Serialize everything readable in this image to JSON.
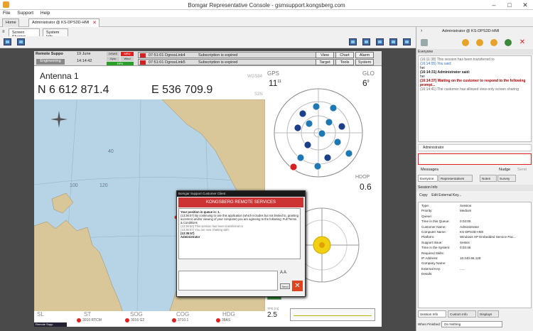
{
  "window": {
    "title": "Bomgar Representative Console - gsmsupport.kongsberg.com"
  },
  "menu": [
    "File",
    "Support",
    "Help"
  ],
  "tabs": {
    "home": "Home",
    "session": "Administrator @ KS-DPS3D-HMI"
  },
  "subtabs": [
    "Screen Sharing",
    "System Info"
  ],
  "remote": {
    "header": {
      "left_label": "Remote Suppo",
      "date": "19 June",
      "time": "14:14:42",
      "mode": "Engineering",
      "ind1": "DSWS",
      "ind2": "MRU",
      "ind3": "Gyro",
      "ind4": "Wind",
      "ind5": "RPS"
    },
    "alarms": [
      {
        "time": "07:51:01",
        "name": "DgnssLink4",
        "msg": "Subscription is expired"
      },
      {
        "time": "07:51:01",
        "name": "DgnssLink5",
        "msg": "Subscription is expired"
      }
    ],
    "buttons": [
      "View",
      "Chart",
      "Alarm",
      "Target",
      "Tools",
      "System"
    ],
    "antenna": "Antenna 1",
    "north": "N 6 612 871.4",
    "east": "E 536 709.9",
    "datum": "WGS84",
    "s2n": "S2N",
    "gps_label": "GPS",
    "gps_value": "11",
    "gps_sub": "11",
    "glo_label": "GLO",
    "glo_value": "6",
    "glo_sub": "9",
    "hdop_label": "HDOP",
    "hdop_value": "0.6",
    "grid_labels": [
      "40",
      "120",
      "100"
    ],
    "bottom": {
      "labels": [
        "SL",
        "ST",
        "SOG",
        "COG",
        "HDG"
      ],
      "values": [
        "3010 RTCM",
        "3016 G2",
        "3710.1",
        "38AS"
      ],
      "status_label": "Remote Supp"
    },
    "h_value": "2.5",
    "h_label": "TPE [m]"
  },
  "chat_popup": {
    "title": "Bomgar Support Customer Client",
    "header": "KONGSBERG REMOTE SERVICES",
    "lines": [
      {
        "t": "Your position in queue is: 1.",
        "b": true
      },
      {
        "t": "(13:36:07) By continuing to use this application (which includes but not limited to, granting access to and/or viewing of your computer) you are agreeing to the following:  Full Terms & Conditions",
        "b": false
      },
      {
        "t": "(13:36:50) This session has been transferred to",
        "b": false
      },
      {
        "t": "(13:36:57) You are now chatting with:",
        "b": false
      },
      {
        "t": "(13:35:57)",
        "b": true
      },
      {
        "t": "Administrator",
        "b": true
      }
    ],
    "send": "Send",
    "aa": "A A"
  },
  "right_panel": {
    "session_title": "Administrator @ KS-DPS3D-HMI",
    "everyone_label": "Everyone",
    "chat": [
      {
        "t": "(16:11:38) This session has been transferred to",
        "c": "g"
      },
      {
        "t": "(16:14:05) You said:",
        "c": "l"
      },
      {
        "t": "hei",
        "c": ""
      },
      {
        "t": "(16:14:31) Administrator said:",
        "c": "b"
      },
      {
        "t": "hei",
        "c": ""
      },
      {
        "t": "(16:14:37) Waiting on the customer to respond to the following prompt...",
        "c": "b"
      },
      {
        "t": "(16:14:41) The customer has allowed view-only screen sharing",
        "c": "g"
      }
    ],
    "user": "Administrator",
    "messages_label": "Messages",
    "nudge": "Nudge",
    "send": "Send",
    "chat_tabs": [
      "Everyone",
      "Representatives",
      "Notes",
      "Survey"
    ],
    "session_info_label": "Session Info",
    "tools": [
      "Copy",
      "Edit External Key..."
    ],
    "info": [
      [
        "Type:",
        "Session"
      ],
      [
        "Priority:",
        "Medium"
      ],
      [
        "Queue:",
        ""
      ],
      [
        "Time in this Queue:",
        "0:03:00"
      ],
      [
        "Customer Name:",
        "Administrator"
      ],
      [
        "Computer Name:",
        "KS-DPS3D-HMI"
      ],
      [
        "Platform:",
        "Windows XP Embedded Service Pac..."
      ],
      [
        "Support Issue:",
        "Sestec"
      ],
      [
        "Time in the System:",
        "0:03:46"
      ],
      [
        "Required Skills:",
        ""
      ],
      [
        "IP Address:",
        "10.240.66.128"
      ],
      [
        "Company Name:",
        ""
      ],
      [
        "External Key:",
        "......"
      ],
      [
        "Details:",
        ""
      ]
    ],
    "bottom_tabs": [
      "Session Info",
      "Custom Info",
      "Displays"
    ],
    "when_finished": "When Finished:",
    "when_finished_value": "Do Nothing"
  },
  "colors": {
    "accent": "#d62020",
    "map_water": "#b7d3e6",
    "map_land": "#d9c79a",
    "satellite": "#1e78b4",
    "sat_red": "#d62020"
  }
}
